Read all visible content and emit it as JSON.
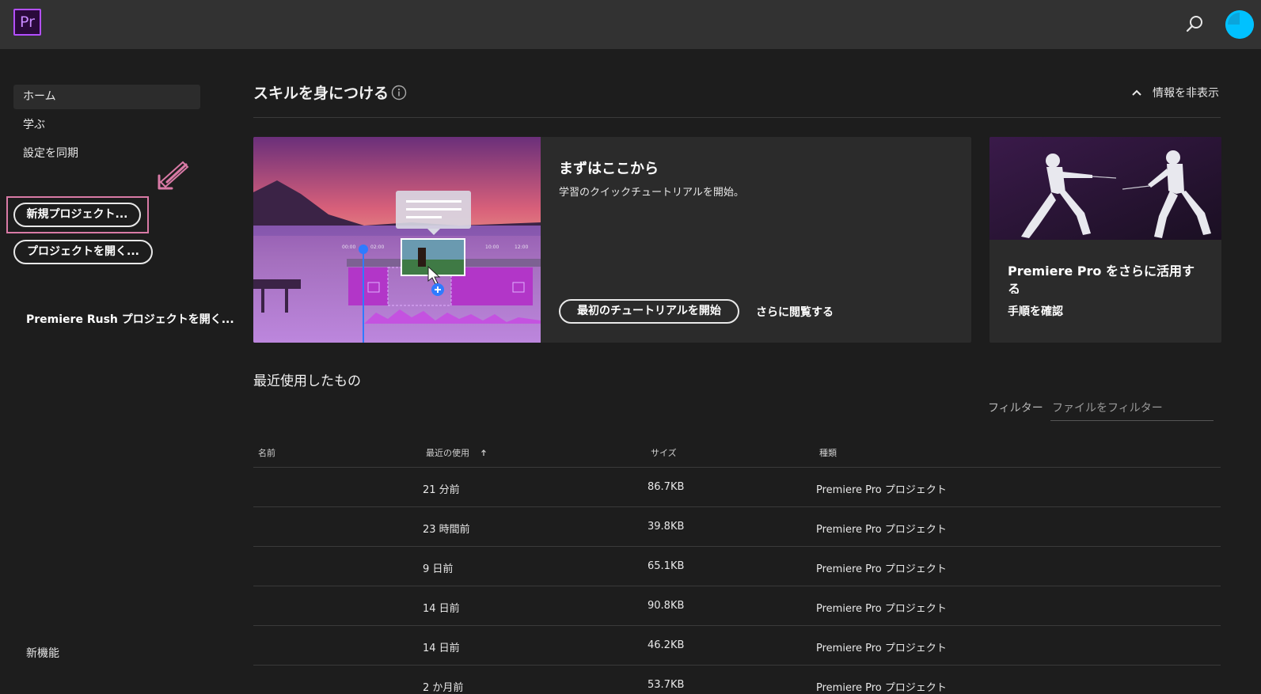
{
  "app": {
    "logo_text": "Pr",
    "brand_color": "#9999ff",
    "accent_color": "#00c1ff"
  },
  "topbar": {
    "search_icon": "search-icon",
    "avatar_icon": "avatar"
  },
  "sidebar": {
    "items": [
      {
        "label": "ホーム",
        "active": true
      },
      {
        "label": "学ぶ",
        "active": false
      },
      {
        "label": "設定を同期",
        "active": false
      }
    ],
    "new_project_label": "新規プロジェクト...",
    "open_project_label": "プロジェクトを開く...",
    "rush_label": "Premiere Rush プロジェクトを開く...",
    "whats_new_label": "新機能"
  },
  "skills": {
    "title": "スキルを身につける",
    "hide_info_label": "情報を非表示",
    "main_card": {
      "title": "まずはここから",
      "subtitle": "学習のクイックチュートリアルを開始。",
      "button_label": "最初のチュートリアルを開始",
      "link_label": "さらに閲覧する",
      "timeline_ticks": [
        "00:00",
        "02:00",
        "10:00",
        "12:00"
      ]
    },
    "side_card": {
      "title": "Premiere Pro をさらに活用する",
      "link_label": "手順を確認"
    }
  },
  "recent": {
    "title": "最近使用したもの",
    "filter_label": "フィルター",
    "filter_placeholder": "ファイルをフィルター",
    "columns": {
      "name": "名前",
      "used": "最近の使用",
      "size": "サイズ",
      "kind": "種類"
    },
    "rows": [
      {
        "name": "",
        "used": "21 分前",
        "size": "86.7KB",
        "kind": "Premiere Pro プロジェクト"
      },
      {
        "name": "",
        "used": "23 時間前",
        "size": "39.8KB",
        "kind": "Premiere Pro プロジェクト"
      },
      {
        "name": "",
        "used": "9 日前",
        "size": "65.1KB",
        "kind": "Premiere Pro プロジェクト"
      },
      {
        "name": "",
        "used": "14 日前",
        "size": "90.8KB",
        "kind": "Premiere Pro プロジェクト"
      },
      {
        "name": "",
        "used": "14 日前",
        "size": "46.2KB",
        "kind": "Premiere Pro プロジェクト"
      },
      {
        "name": "",
        "used": "2 か月前",
        "size": "53.7KB",
        "kind": "Premiere Pro プロジェクト"
      }
    ]
  }
}
